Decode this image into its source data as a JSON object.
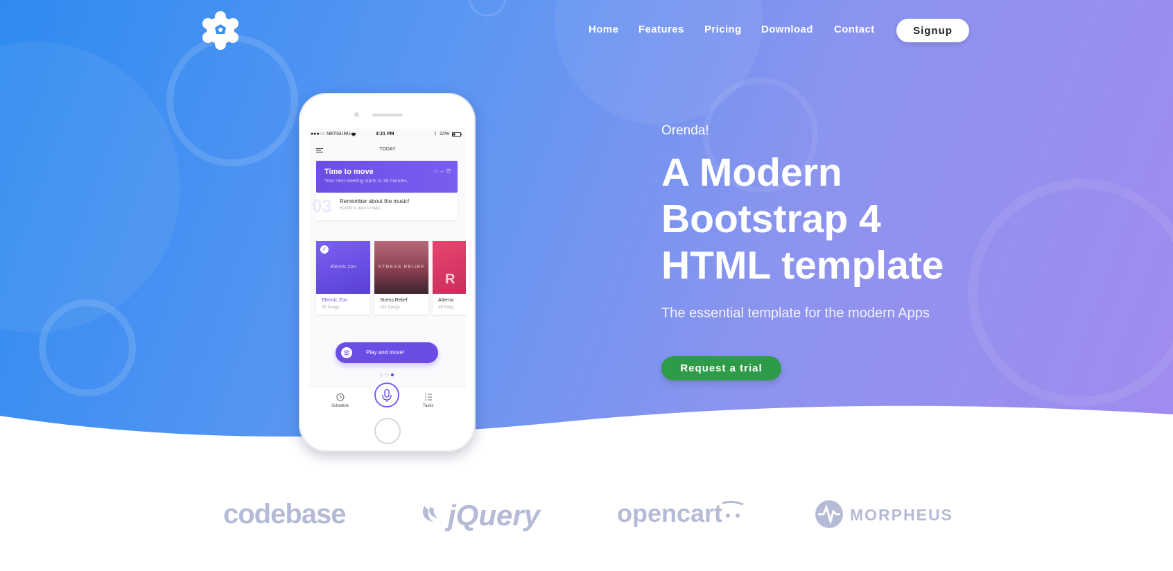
{
  "nav": {
    "links": [
      "Home",
      "Features",
      "Pricing",
      "Download",
      "Contact"
    ],
    "signup_label": "Signup"
  },
  "hero": {
    "eyebrow": "Orenda!",
    "headline_lines": [
      "A Modern",
      "Bootstrap 4",
      "HTML template"
    ],
    "subline": "The essential template for the modern Apps",
    "cta_label": "Request a trial"
  },
  "phone": {
    "status": {
      "carrier": "●●●○○ NETGURU",
      "time": "4:21 PM",
      "battery": "22%"
    },
    "header": "TODAY",
    "card_primary": {
      "title": "Time to move",
      "subtitle": "Your next meeting starts in 30 minutes."
    },
    "card_secondary": {
      "number": "03",
      "title": "Remember about the music!",
      "subtitle": "Spotify is here to help."
    },
    "albums": [
      {
        "name": "Electric Zoo",
        "count": "25 Songs",
        "overlay": "Electric Zoo"
      },
      {
        "name": "Stress Relief",
        "count": "182 Songs",
        "overlay": "STRESS RELIEF"
      },
      {
        "name": "Alterna",
        "count": "49 Song",
        "overlay": "R"
      }
    ],
    "play_label": "Play and move!",
    "tabs": [
      "Schedule",
      "Tasks"
    ]
  },
  "partners": [
    "codebase",
    "jQuery",
    "opencart",
    "MORPHEUS"
  ],
  "colors": {
    "gradient_start": "#2f8bf0",
    "gradient_end": "#a18bee",
    "cta_green": "#2e9b48",
    "app_purple": "#6c4ee6",
    "partner_gray": "#b5bbd6"
  },
  "icons": [
    "gear-logo-icon",
    "wifi-icon",
    "bluetooth-icon",
    "battery-icon",
    "menu-icon",
    "home-icon",
    "car-icon",
    "check-icon",
    "spotify-icon",
    "clock-icon",
    "microphone-icon",
    "list-icon"
  ]
}
